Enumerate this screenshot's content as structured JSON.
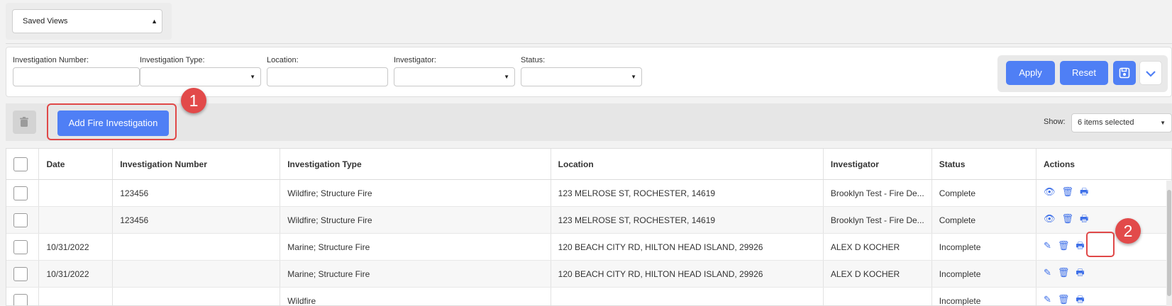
{
  "saved_views": {
    "label": "Saved Views"
  },
  "filters": {
    "investigation_number_label": "Investigation Number:",
    "investigation_type_label": "Investigation Type:",
    "location_label": "Location:",
    "investigator_label": "Investigator:",
    "status_label": "Status:"
  },
  "buttons": {
    "apply": "Apply",
    "reset": "Reset",
    "add_fire_investigation": "Add Fire Investigation"
  },
  "show": {
    "label": "Show:",
    "value": "6 items selected"
  },
  "annotations": {
    "one": "1",
    "two": "2"
  },
  "table": {
    "headers": [
      "Date",
      "Investigation Number",
      "Investigation Type",
      "Location",
      "Investigator",
      "Status",
      "Actions"
    ],
    "rows": [
      {
        "date": "",
        "number": "123456",
        "type": "Wildfire; Structure Fire",
        "location": "123 MELROSE ST, ROCHESTER, 14619",
        "investigator": "Brooklyn Test - Fire De...",
        "status": "Complete",
        "first_action": "view-icon"
      },
      {
        "date": "",
        "number": "123456",
        "type": "Wildfire; Structure Fire",
        "location": "123 MELROSE ST, ROCHESTER, 14619",
        "investigator": "Brooklyn Test - Fire De...",
        "status": "Complete",
        "first_action": "view-icon"
      },
      {
        "date": "10/31/2022",
        "number": "",
        "type": "Marine; Structure Fire",
        "location": "120 BEACH CITY RD, HILTON HEAD ISLAND, 29926",
        "investigator": "ALEX D KOCHER",
        "status": "Incomplete",
        "first_action": "edit-icon"
      },
      {
        "date": "10/31/2022",
        "number": "",
        "type": "Marine; Structure Fire",
        "location": "120 BEACH CITY RD, HILTON HEAD ISLAND, 29926",
        "investigator": "ALEX D KOCHER",
        "status": "Incomplete",
        "first_action": "edit-icon"
      },
      {
        "date": "",
        "number": "",
        "type": "Wildfire",
        "location": "",
        "investigator": "",
        "status": "Incomplete",
        "first_action": "edit-icon"
      }
    ]
  },
  "colors": {
    "accent": "#4f7ff5",
    "annotation": "#e24a4a"
  }
}
